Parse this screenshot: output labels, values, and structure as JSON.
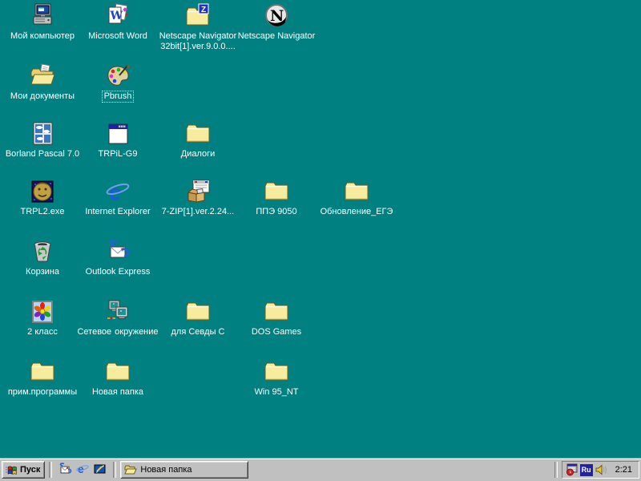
{
  "desktop": {
    "background_color": "#008080",
    "icons": [
      {
        "id": "my-computer",
        "glyph": "computer",
        "label_lines": [
          "Мой компьютер"
        ],
        "shortcut": false,
        "selected": false,
        "col": 1,
        "row": 1
      },
      {
        "id": "microsoft-word",
        "glyph": "word",
        "label_lines": [
          "Microsoft Word"
        ],
        "shortcut": true,
        "selected": false,
        "col": 2,
        "row": 1
      },
      {
        "id": "netscape-folder",
        "glyph": "folder-z",
        "label_lines": [
          "Netscape Navigator",
          "32bit[1].ver.9.0.0...."
        ],
        "shortcut": false,
        "selected": false,
        "col": 3,
        "row": 1
      },
      {
        "id": "netscape-navigator",
        "glyph": "netscape",
        "label_lines": [
          "Netscape Navigator"
        ],
        "shortcut": true,
        "selected": false,
        "col": 4,
        "row": 1
      },
      {
        "id": "my-documents",
        "glyph": "folder-docs",
        "label_lines": [
          "Мои документы"
        ],
        "shortcut": false,
        "selected": false,
        "col": 1,
        "row": 2
      },
      {
        "id": "pbrush",
        "glyph": "palette",
        "label_lines": [
          "Pbrush"
        ],
        "shortcut": true,
        "selected": true,
        "col": 2,
        "row": 2
      },
      {
        "id": "borland-pascal",
        "glyph": "window-clouds",
        "label_lines": [
          "Borland Pascal 7.0"
        ],
        "shortcut": true,
        "selected": false,
        "col": 1,
        "row": 3
      },
      {
        "id": "trpil-g9",
        "glyph": "app-window",
        "label_lines": [
          "TRPiL-G9"
        ],
        "shortcut": true,
        "selected": false,
        "col": 2,
        "row": 3
      },
      {
        "id": "dialogi",
        "glyph": "folder",
        "label_lines": [
          "Диалоги"
        ],
        "shortcut": false,
        "selected": false,
        "col": 3,
        "row": 3
      },
      {
        "id": "trpl2-exe",
        "glyph": "trpl",
        "label_lines": [
          "TRPL2.exe"
        ],
        "shortcut": true,
        "selected": false,
        "col": 1,
        "row": 4
      },
      {
        "id": "internet-explorer",
        "glyph": "ie",
        "label_lines": [
          "Internet Explorer"
        ],
        "shortcut": false,
        "selected": false,
        "col": 2,
        "row": 4
      },
      {
        "id": "seven-zip",
        "glyph": "installer",
        "label_lines": [
          "7-ZIP[1].ver.2.24..."
        ],
        "shortcut": false,
        "selected": false,
        "col": 3,
        "row": 4
      },
      {
        "id": "ppe-9050",
        "glyph": "folder",
        "label_lines": [
          "ППЭ 9050"
        ],
        "shortcut": false,
        "selected": false,
        "col": 4,
        "row": 4
      },
      {
        "id": "obnovlenie-ege",
        "glyph": "folder",
        "label_lines": [
          "Обновление_ЕГЭ"
        ],
        "shortcut": false,
        "selected": false,
        "col": 5,
        "row": 4
      },
      {
        "id": "recycle-bin",
        "glyph": "recycle",
        "label_lines": [
          "Корзина"
        ],
        "shortcut": false,
        "selected": false,
        "col": 1,
        "row": 5
      },
      {
        "id": "outlook-express",
        "glyph": "outlook",
        "label_lines": [
          "Outlook Express"
        ],
        "shortcut": true,
        "selected": false,
        "col": 2,
        "row": 5
      },
      {
        "id": "klass-2",
        "glyph": "flower",
        "label_lines": [
          "2 класс"
        ],
        "shortcut": true,
        "selected": false,
        "col": 1,
        "row": 6
      },
      {
        "id": "network-neighborhood",
        "glyph": "network",
        "label_lines": [
          "Сетевое",
          "окружение"
        ],
        "shortcut": false,
        "selected": false,
        "col": 2,
        "row": 6
      },
      {
        "id": "dlya-sevdy",
        "glyph": "folder",
        "label_lines": [
          "для Севды С"
        ],
        "shortcut": false,
        "selected": false,
        "col": 3,
        "row": 6
      },
      {
        "id": "dos-games",
        "glyph": "folder",
        "label_lines": [
          "DOS Games"
        ],
        "shortcut": false,
        "selected": false,
        "col": 4,
        "row": 6
      },
      {
        "id": "prim-programmy",
        "glyph": "folder",
        "label_lines": [
          "прим.программы"
        ],
        "shortcut": false,
        "selected": false,
        "col": 1,
        "row": 7
      },
      {
        "id": "novaya-papka",
        "glyph": "folder",
        "label_lines": [
          "Новая папка"
        ],
        "shortcut": false,
        "selected": false,
        "col": 2,
        "row": 7
      },
      {
        "id": "win95-nt",
        "glyph": "folder",
        "label_lines": [
          "Win 95_NT"
        ],
        "shortcut": false,
        "selected": false,
        "col": 4,
        "row": 7
      }
    ],
    "grid": {
      "col_centers": [
        53,
        147,
        247,
        345,
        445
      ],
      "row_tops": [
        4,
        79,
        151,
        223,
        298,
        373,
        448
      ]
    }
  },
  "taskbar": {
    "start_label": "Пуск",
    "quick_launch": [
      {
        "id": "launch-outlook-express",
        "glyph": "ql-outlook"
      },
      {
        "id": "launch-internet-explorer",
        "glyph": "ql-ie"
      },
      {
        "id": "show-desktop",
        "glyph": "ql-desktop"
      }
    ],
    "tasks": [
      {
        "label": "Новая папка"
      }
    ],
    "tray": {
      "language": "Ru",
      "clock": "2:21"
    }
  }
}
